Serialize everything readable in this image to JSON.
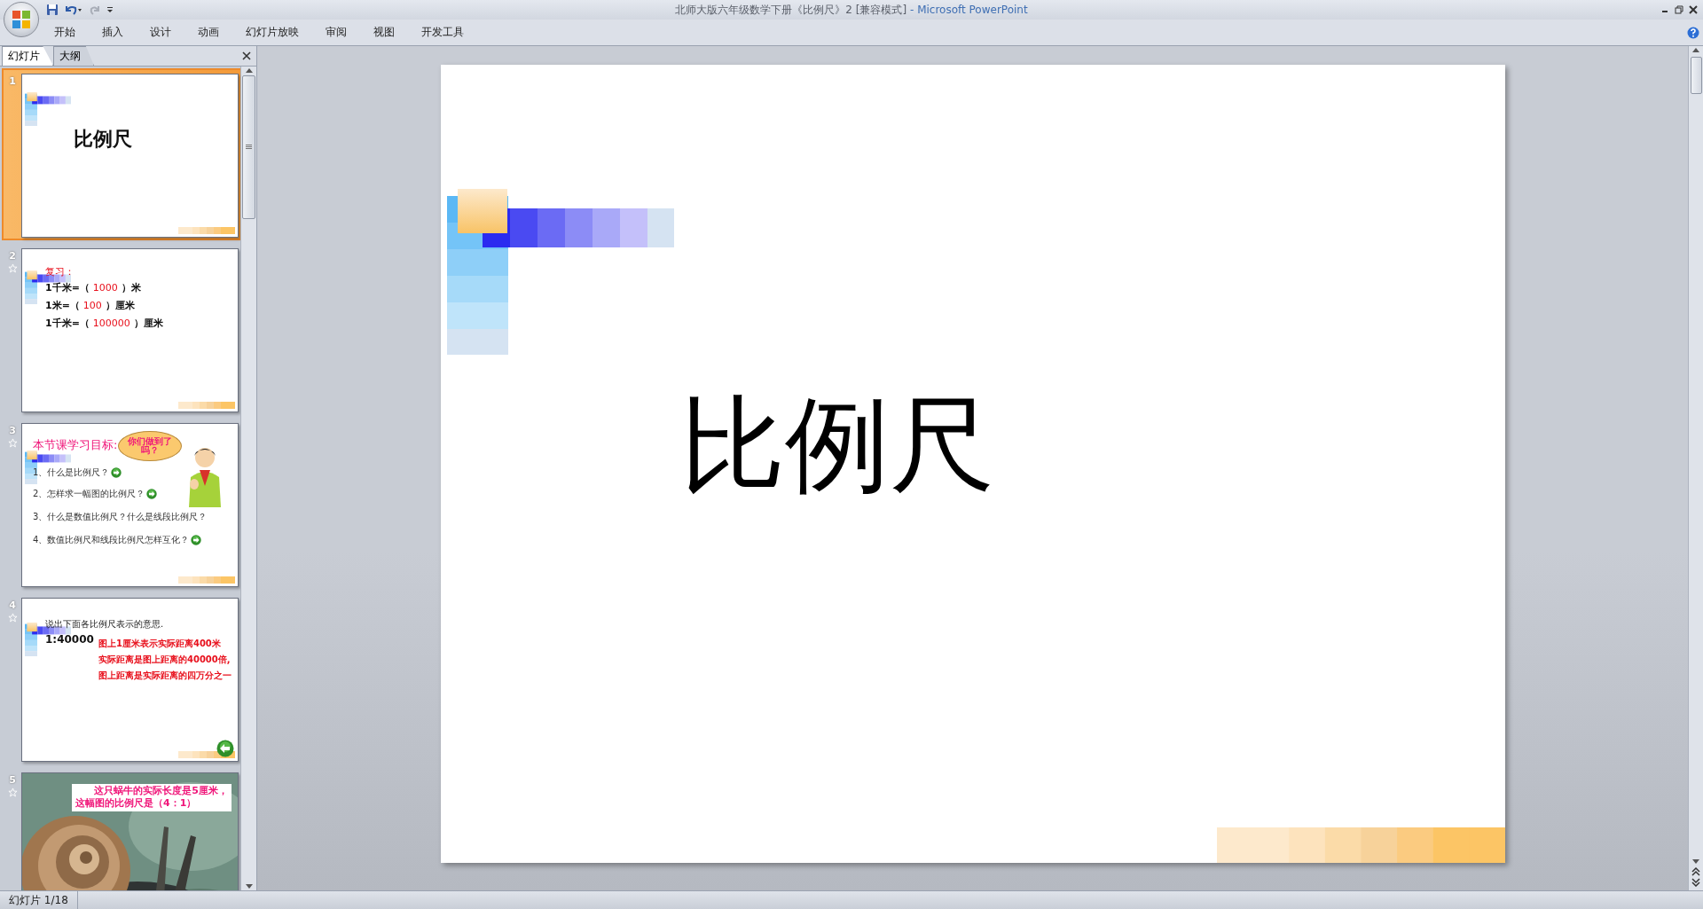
{
  "window": {
    "title": "北师大版六年级数学下册《比例尺》2 [兼容模式]",
    "app": " - Microsoft PowerPoint"
  },
  "ribbon_tabs": [
    "开始",
    "插入",
    "设计",
    "动画",
    "幻灯片放映",
    "审阅",
    "视图",
    "开发工具"
  ],
  "pane_tabs": [
    {
      "label": "幻灯片",
      "selected": true
    },
    {
      "label": "大纲",
      "selected": false
    }
  ],
  "slides": [
    {
      "number": "1",
      "selected": true,
      "animated": false,
      "kind": "title",
      "title": "比例尺"
    },
    {
      "number": "2",
      "selected": false,
      "animated": true,
      "kind": "review",
      "heading": "复习：",
      "lines": [
        {
          "before": "1千米=（",
          "answer": "1000",
          "after": "）米"
        },
        {
          "before": "1米=（",
          "answer": "100",
          "after": "）厘米"
        },
        {
          "before": "1千米=（",
          "answer": "100000",
          "after": "）厘米"
        }
      ]
    },
    {
      "number": "3",
      "selected": false,
      "animated": true,
      "kind": "goals",
      "heading": "本节课学习目标:",
      "bubble": "你们做到了吗？",
      "items": [
        {
          "text": "1、什么是比例尺？",
          "linked": true
        },
        {
          "text": "2、怎样求一幅图的比例尺？",
          "linked": true
        },
        {
          "text": "3、什么是数值比例尺？什么是线段比例尺？",
          "linked": false
        },
        {
          "text": "4、数值比例尺和线段比例尺怎样互化？",
          "linked": true
        }
      ]
    },
    {
      "number": "4",
      "selected": false,
      "animated": true,
      "kind": "scale",
      "instruction": "说出下面各比例尺表示的意思.",
      "ratio": "1:40000",
      "lines": [
        "图上1厘米表示实际距离400米",
        "实际距离是图上距离的40000倍,",
        "图上距离是实际距离的四万分之一"
      ]
    },
    {
      "number": "5",
      "selected": false,
      "animated": true,
      "caption_lines": [
        "这只蜗牛的实际长度是5厘米，",
        "这幅图的比例尺是（4：1）"
      ]
    }
  ],
  "current_slide": {
    "title": "比例尺"
  },
  "status_bar": {
    "slide_position": "幻灯片 1/18"
  }
}
